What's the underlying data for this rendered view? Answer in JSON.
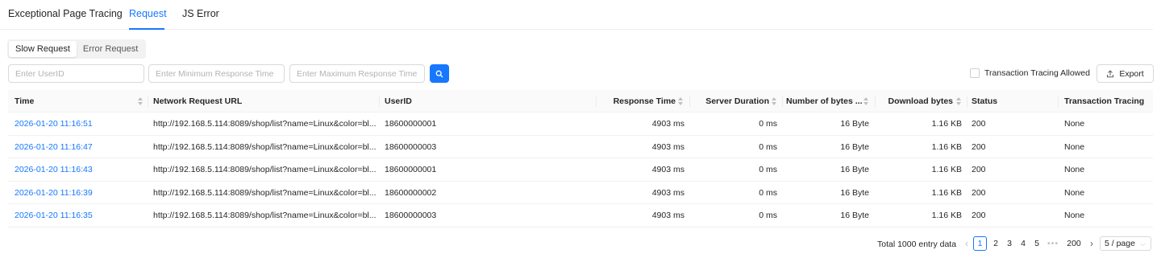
{
  "tabs": [
    {
      "label": "Exceptional Page Tracing",
      "active": false
    },
    {
      "label": "Request",
      "active": true
    },
    {
      "label": "JS Error",
      "active": false
    }
  ],
  "segmented": {
    "items": [
      "Slow Request",
      "Error Request"
    ],
    "active": 0
  },
  "filters": {
    "user_id_placeholder": "Enter UserID",
    "min_time_placeholder": "Enter Minimum Response Time",
    "max_time_placeholder": "Enter Maximum Response Time",
    "search_icon": "search-icon"
  },
  "toolbar": {
    "tracing_allowed_label": "Transaction Tracing Allowed",
    "tracing_allowed_checked": false,
    "export_label": "Export",
    "export_icon": "export-icon"
  },
  "colors": {
    "accent": "#1677ff",
    "header_bg": "#fafafa",
    "border": "#f0f0f0"
  },
  "table": {
    "columns": [
      "Time",
      "Network Request URL",
      "UserID",
      "Response Time",
      "Server Duration",
      "Number of bytes ...",
      "Download bytes",
      "Status",
      "Transaction Tracing"
    ],
    "rows": [
      {
        "time": "2026-01-20 11:16:51",
        "url": "http://192.168.5.114:8089/shop/list?name=Linux&color=bl...",
        "user_id": "18600000001",
        "response_time": "4903 ms",
        "server_duration": "0 ms",
        "bytes": "16 Byte",
        "download": "1.16 KB",
        "status": "200",
        "tracing": "None"
      },
      {
        "time": "2026-01-20 11:16:47",
        "url": "http://192.168.5.114:8089/shop/list?name=Linux&color=bl...",
        "user_id": "18600000003",
        "response_time": "4903 ms",
        "server_duration": "0 ms",
        "bytes": "16 Byte",
        "download": "1.16 KB",
        "status": "200",
        "tracing": "None"
      },
      {
        "time": "2026-01-20 11:16:43",
        "url": "http://192.168.5.114:8089/shop/list?name=Linux&color=bl...",
        "user_id": "18600000001",
        "response_time": "4903 ms",
        "server_duration": "0 ms",
        "bytes": "16 Byte",
        "download": "1.16 KB",
        "status": "200",
        "tracing": "None"
      },
      {
        "time": "2026-01-20 11:16:39",
        "url": "http://192.168.5.114:8089/shop/list?name=Linux&color=bl...",
        "user_id": "18600000002",
        "response_time": "4903 ms",
        "server_duration": "0 ms",
        "bytes": "16 Byte",
        "download": "1.16 KB",
        "status": "200",
        "tracing": "None"
      },
      {
        "time": "2026-01-20 11:16:35",
        "url": "http://192.168.5.114:8089/shop/list?name=Linux&color=bl...",
        "user_id": "18600000003",
        "response_time": "4903 ms",
        "server_duration": "0 ms",
        "bytes": "16 Byte",
        "download": "1.16 KB",
        "status": "200",
        "tracing": "None"
      }
    ]
  },
  "pagination": {
    "total_label": "Total 1000 entry data",
    "pages": [
      "1",
      "2",
      "3",
      "4",
      "5"
    ],
    "current": "1",
    "ellipsis": "•••",
    "last_page": "200",
    "prev_icon": "chevron-left-icon",
    "next_icon": "chevron-right-icon",
    "page_size_label": "5 / page"
  }
}
